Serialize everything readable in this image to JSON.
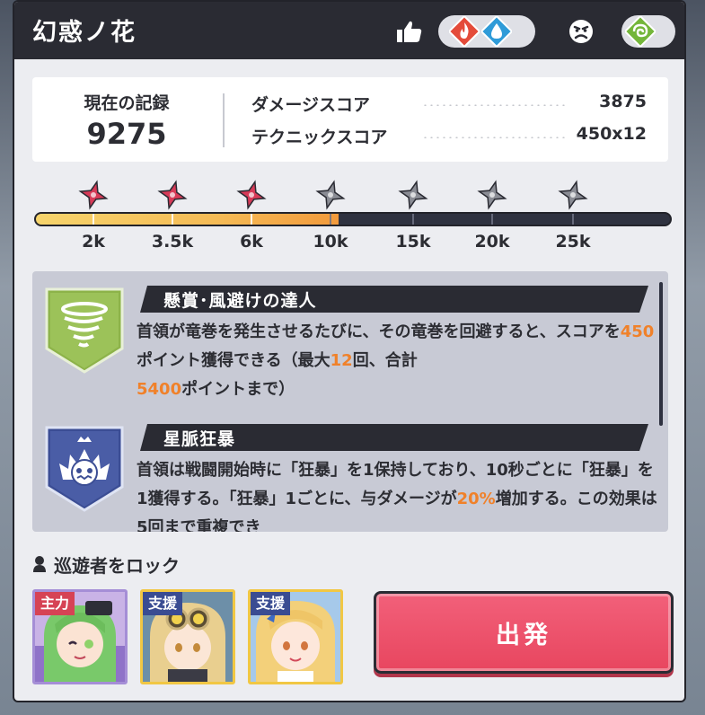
{
  "header": {
    "title": "幻惑ノ花",
    "weakness_icons": [
      "fire-element-icon",
      "water-element-icon"
    ],
    "resist_icons": [
      "wind-element-icon"
    ],
    "colors": {
      "header_bg": "#2a2b33",
      "fire": "#e44b3a",
      "water": "#2f9bd8",
      "wind": "#74b63a"
    }
  },
  "record": {
    "label": "現在の記録",
    "value": "9275",
    "damage_label": "ダメージスコア",
    "damage_value": "3875",
    "technique_label": "テクニックスコア",
    "technique_value": "450x12"
  },
  "progress": {
    "fill_fraction": 0.478,
    "milestones": [
      {
        "label": "2k",
        "achieved": true
      },
      {
        "label": "3.5k",
        "achieved": true
      },
      {
        "label": "6k",
        "achieved": true
      },
      {
        "label": "10k",
        "achieved": false
      },
      {
        "label": "15k",
        "achieved": false
      },
      {
        "label": "20k",
        "achieved": false
      },
      {
        "label": "25k",
        "achieved": false
      }
    ],
    "colors": {
      "achieved_star": "#d63a57",
      "locked_star": "#8a8c94",
      "fill": "#f5bb56"
    }
  },
  "bounties": [
    {
      "title": "懸賞･風避けの達人",
      "icon": "tornado-icon",
      "desc_a": "首領が竜巻を発生させるたびに、その竜巻を回避すると、スコアを",
      "hl1": "450",
      "desc_b": "ポイント獲得できる（最大",
      "hl2": "12",
      "desc_c": "回、合計",
      "hl3": "5400",
      "desc_d": "ポイントまで）"
    },
    {
      "title": "星脈狂暴",
      "icon": "berserk-monster-icon",
      "desc_a": "首領は戦闘開始時に「狂暴」を1保持しており、10秒ごとに「狂暴」を1獲得する。「狂暴」1ごとに、与ダメージが",
      "hl1": "20%",
      "desc_b": "増加する。この効果は5回まで重複でき"
    }
  ],
  "lock": {
    "label": "巡遊者をロック"
  },
  "team": [
    {
      "tag": "主力",
      "role": "main"
    },
    {
      "tag": "支援",
      "role": "support"
    },
    {
      "tag": "支援",
      "role": "support"
    }
  ],
  "depart": {
    "label": "出発"
  }
}
